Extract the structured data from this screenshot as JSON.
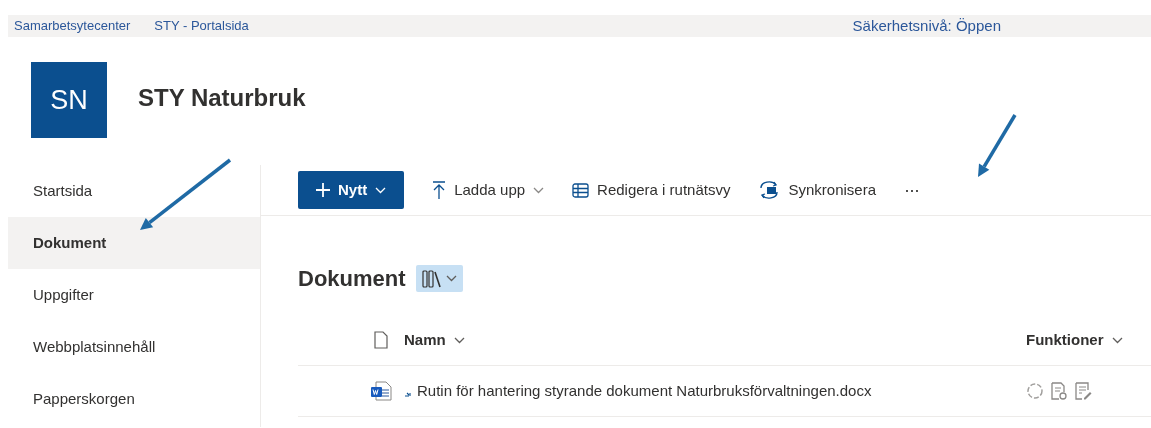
{
  "breadcrumb": [
    {
      "label": "Samarbetsytecenter"
    },
    {
      "label": "STY - Portalsida"
    }
  ],
  "security": "Säkerhetsnivå: Öppen",
  "site": {
    "logo": "SN",
    "title": "STY Naturbruk"
  },
  "nav": [
    {
      "label": "Startsida",
      "selected": false
    },
    {
      "label": "Dokument",
      "selected": true
    },
    {
      "label": "Uppgifter",
      "selected": false
    },
    {
      "label": "Webbplatsinnehåll",
      "selected": false
    },
    {
      "label": "Papperskorgen",
      "selected": false
    }
  ],
  "toolbar": [
    {
      "kind": "primary",
      "label": "Nytt"
    },
    {
      "kind": "upload",
      "label": "Ladda upp"
    },
    {
      "kind": "grid",
      "label": "Redigera i rutnätsvy"
    },
    {
      "kind": "sync",
      "label": "Synkronisera"
    },
    {
      "kind": "more",
      "label": "···"
    }
  ],
  "library": {
    "title": "Dokument"
  },
  "table": {
    "columns": [
      {
        "label": "Namn"
      },
      {
        "label": "Funktioner"
      }
    ],
    "rows": [
      {
        "name": "Rutin för hantering styrande dokument Naturbruksförvaltningen.docx",
        "is_new": true
      }
    ]
  }
}
